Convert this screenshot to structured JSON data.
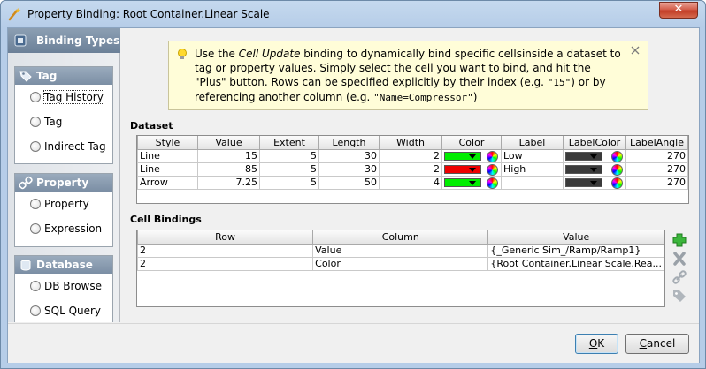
{
  "window": {
    "title": "Property Binding: Root Container.Linear Scale",
    "close_glyph": "✕"
  },
  "sidebar": {
    "header": "Binding Types",
    "groups": [
      {
        "label": "Tag",
        "items": [
          {
            "label": "Tag History"
          },
          {
            "label": "Tag"
          },
          {
            "label": "Indirect Tag"
          }
        ]
      },
      {
        "label": "Property",
        "items": [
          {
            "label": "Property"
          },
          {
            "label": "Expression"
          }
        ]
      },
      {
        "label": "Database",
        "items": [
          {
            "label": "DB Browse"
          },
          {
            "label": "SQL Query"
          }
        ]
      }
    ]
  },
  "tip": {
    "t1": "Use the ",
    "t2": "Cell Update",
    "t3": " binding to dynamically bind specific cellsinside a dataset to tag or property values. Simply select the cell you want to bind, and hit the \"Plus\" button. Rows can be specified explicitly by their index (e.g. ",
    "c1": "\"15\"",
    "t4": ") or by referencing another column (e.g. ",
    "c2": "\"Name=Compressor\"",
    "t5": ")"
  },
  "dataset": {
    "label": "Dataset",
    "columns": [
      "Style",
      "Value",
      "Extent",
      "Length",
      "Width",
      "Color",
      "Label",
      "LabelColor",
      "LabelAngle"
    ],
    "rows": [
      {
        "style": "Line",
        "value": "15",
        "extent": "5",
        "length": "30",
        "width": "2",
        "color": "#00ee00",
        "label": "Low",
        "label_color": "#3a3a3a",
        "label_angle": "270"
      },
      {
        "style": "Line",
        "value": "85",
        "extent": "5",
        "length": "30",
        "width": "2",
        "color": "#ee0000",
        "label": "High",
        "label_color": "#3a3a3a",
        "label_angle": "270"
      },
      {
        "style": "Arrow",
        "value": "7.25",
        "extent": "5",
        "length": "50",
        "width": "4",
        "color": "#00ee00",
        "label": "",
        "label_color": "#3a3a3a",
        "label_angle": "270"
      }
    ]
  },
  "cell_bindings": {
    "label": "Cell Bindings",
    "columns": [
      "Row",
      "Column",
      "Value"
    ],
    "rows": [
      {
        "row": "2",
        "column": "Value",
        "value": "{_Generic Sim_/Ramp/Ramp1}"
      },
      {
        "row": "2",
        "column": "Color",
        "value": "{Root Container.Linear Scale.Rea..."
      }
    ]
  },
  "tools": [
    "add-icon",
    "delete-icon",
    "edit-link-icon",
    "tag-icon"
  ],
  "buttons": {
    "ok": {
      "underlined": "O",
      "rest": "K"
    },
    "cancel": {
      "underlined": "C",
      "rest": "ancel"
    }
  }
}
